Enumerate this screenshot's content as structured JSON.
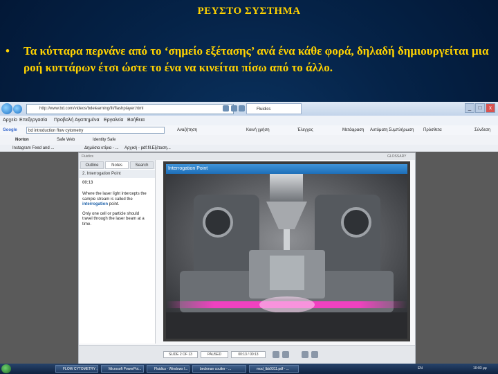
{
  "slide": {
    "title": "ΡΕΥΣΤΟ ΣΥΣΤΗΜΑ",
    "bullet_symbol": "•",
    "bullet_text": "Τα κύτταρα περνάνε από το ‘σημείο εξέτασης’ ανά ένα κάθε φορά, δηλαδή δημιουργείται μια ροή κυττάρων έτσι ώστε το ένα να κινείται πίσω από το άλλο."
  },
  "browser": {
    "address": "http://www.bd.com/videos/bdelearning/ilt/flashplayer.html",
    "tab_title": "Fluidics",
    "menu": [
      "Αρχείο",
      "Επεξεργασία",
      "Προβολή",
      "Αγαπημένα",
      "Εργαλεία",
      "Βοήθεια"
    ],
    "google_search": "bd introduction flow cytometry",
    "google_items": [
      "Αναζήτηση",
      "Κοινή χρήση",
      "Έλεγχος",
      "Μετάφραση",
      "Αυτόματη Συμπλήρωση",
      "Πρόσθετα",
      "Σύνδεση"
    ],
    "norton_items": [
      "Norton",
      "Safe Web",
      "Identity Safe"
    ],
    "fav_items": [
      "Instagram Feed and ...",
      "Δημόσια κτίρια - ...",
      "Αρχική - pdf.fil.Εξέταση..."
    ],
    "close_glyph": "x",
    "min_glyph": "_",
    "max_glyph": "□"
  },
  "player": {
    "header_left": "Fluidics",
    "header_right": "GLOSSARY",
    "tabs": [
      "Outline",
      "Notes",
      "Search"
    ],
    "lesson": "2. Interrogation Point",
    "time": "00:13",
    "desc1_pre": "Where the laser light intercepts the sample stream is called the ",
    "desc1_bold": "interrogation",
    "desc1_post": " point.",
    "desc2": "Only one cell or particle should travel through the laser beam at a time.",
    "video_title": "Interrogation Point",
    "ctrl_slide": "SLIDE 2 OF 13",
    "ctrl_state": "PAUSED",
    "ctrl_time": "00:13 / 00:13"
  },
  "taskbar": {
    "items": [
      "FLOW CYTOMETRY ...",
      "Microsoft PowerPoi...",
      "Fluidics - Windows I...",
      "beckman coulter - ...",
      "mod_lbb0311.pdf - ..."
    ],
    "lang": "EN",
    "clock": "10:03 μμ"
  },
  "colors": {
    "accent_yellow": "#ffd200",
    "bg_blue": "#052348",
    "laser_pink": "#ff3cc8"
  }
}
